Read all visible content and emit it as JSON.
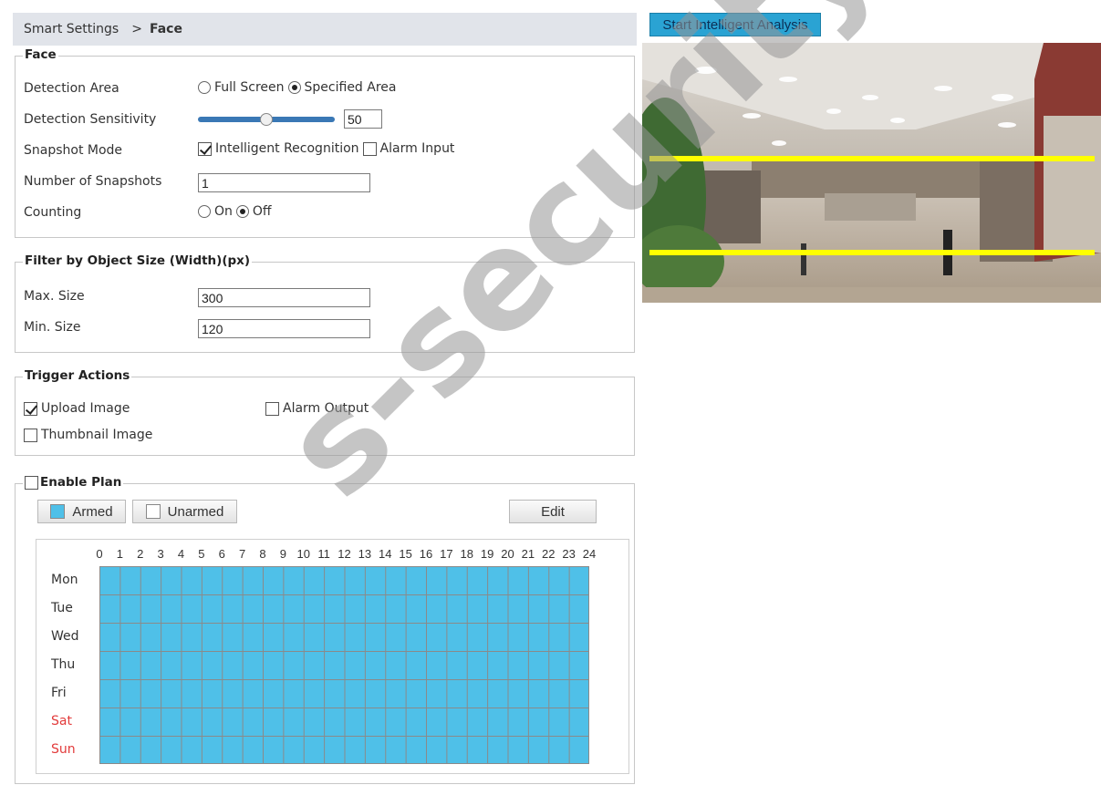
{
  "breadcrumb": {
    "parent": "Smart Settings",
    "separator": ">",
    "current": "Face"
  },
  "face": {
    "legend": "Face",
    "detection_area": {
      "label": "Detection Area",
      "options": [
        "Full Screen",
        "Specified Area"
      ],
      "selected": "Specified Area"
    },
    "sensitivity": {
      "label": "Detection Sensitivity",
      "value": "50",
      "level_percent": 50
    },
    "snapshot_mode": {
      "label": "Snapshot Mode",
      "options": [
        {
          "label": "Intelligent Recognition",
          "checked": true
        },
        {
          "label": "Alarm Input",
          "checked": false
        }
      ]
    },
    "snapshots": {
      "label": "Number of Snapshots",
      "value": "1"
    },
    "counting": {
      "label": "Counting",
      "options": [
        "On",
        "Off"
      ],
      "selected": "Off"
    }
  },
  "filter": {
    "legend": "Filter by Object Size (Width)(px)",
    "max": {
      "label": "Max. Size",
      "value": "300"
    },
    "min": {
      "label": "Min. Size",
      "value": "120"
    }
  },
  "trigger": {
    "legend": "Trigger Actions",
    "upload_image": {
      "label": "Upload Image",
      "checked": true
    },
    "alarm_output": {
      "label": "Alarm Output",
      "checked": false
    },
    "thumbnail_image": {
      "label": "Thumbnail Image",
      "checked": false
    }
  },
  "plan": {
    "legend": "Enable Plan",
    "enabled": false,
    "armed_label": "Armed",
    "unarmed_label": "Unarmed",
    "edit_label": "Edit",
    "hours": [
      "0",
      "1",
      "2",
      "3",
      "4",
      "5",
      "6",
      "7",
      "8",
      "9",
      "10",
      "11",
      "12",
      "13",
      "14",
      "15",
      "16",
      "17",
      "18",
      "19",
      "20",
      "21",
      "22",
      "23",
      "24"
    ],
    "days": [
      "Mon",
      "Tue",
      "Wed",
      "Thu",
      "Fri",
      "Sat",
      "Sun"
    ],
    "weekend_days": [
      "Sat",
      "Sun"
    ],
    "armed_all_week": true
  },
  "preview": {
    "start_button": "Start Intelligent Analysis",
    "line_color": "#ffff00"
  },
  "colors": {
    "armed": "#4fc0e8",
    "accent_button": "#2aa3d3",
    "weekend": "#e23b3b"
  },
  "watermark": "s-security.com"
}
